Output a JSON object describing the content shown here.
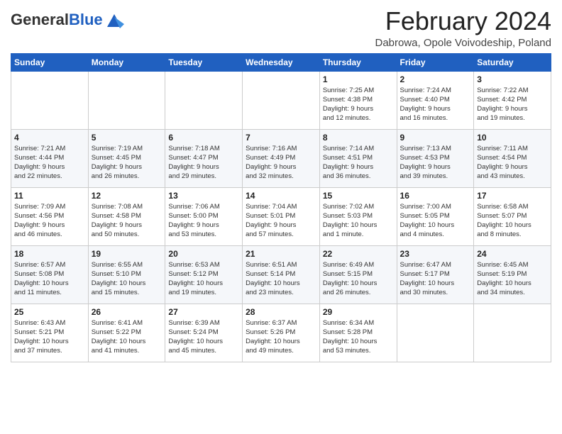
{
  "header": {
    "logo_general": "General",
    "logo_blue": "Blue",
    "month_title": "February 2024",
    "location": "Dabrowa, Opole Voivodeship, Poland"
  },
  "weekdays": [
    "Sunday",
    "Monday",
    "Tuesday",
    "Wednesday",
    "Thursday",
    "Friday",
    "Saturday"
  ],
  "weeks": [
    [
      {
        "day": "",
        "info": ""
      },
      {
        "day": "",
        "info": ""
      },
      {
        "day": "",
        "info": ""
      },
      {
        "day": "",
        "info": ""
      },
      {
        "day": "1",
        "info": "Sunrise: 7:25 AM\nSunset: 4:38 PM\nDaylight: 9 hours\nand 12 minutes."
      },
      {
        "day": "2",
        "info": "Sunrise: 7:24 AM\nSunset: 4:40 PM\nDaylight: 9 hours\nand 16 minutes."
      },
      {
        "day": "3",
        "info": "Sunrise: 7:22 AM\nSunset: 4:42 PM\nDaylight: 9 hours\nand 19 minutes."
      }
    ],
    [
      {
        "day": "4",
        "info": "Sunrise: 7:21 AM\nSunset: 4:44 PM\nDaylight: 9 hours\nand 22 minutes."
      },
      {
        "day": "5",
        "info": "Sunrise: 7:19 AM\nSunset: 4:45 PM\nDaylight: 9 hours\nand 26 minutes."
      },
      {
        "day": "6",
        "info": "Sunrise: 7:18 AM\nSunset: 4:47 PM\nDaylight: 9 hours\nand 29 minutes."
      },
      {
        "day": "7",
        "info": "Sunrise: 7:16 AM\nSunset: 4:49 PM\nDaylight: 9 hours\nand 32 minutes."
      },
      {
        "day": "8",
        "info": "Sunrise: 7:14 AM\nSunset: 4:51 PM\nDaylight: 9 hours\nand 36 minutes."
      },
      {
        "day": "9",
        "info": "Sunrise: 7:13 AM\nSunset: 4:53 PM\nDaylight: 9 hours\nand 39 minutes."
      },
      {
        "day": "10",
        "info": "Sunrise: 7:11 AM\nSunset: 4:54 PM\nDaylight: 9 hours\nand 43 minutes."
      }
    ],
    [
      {
        "day": "11",
        "info": "Sunrise: 7:09 AM\nSunset: 4:56 PM\nDaylight: 9 hours\nand 46 minutes."
      },
      {
        "day": "12",
        "info": "Sunrise: 7:08 AM\nSunset: 4:58 PM\nDaylight: 9 hours\nand 50 minutes."
      },
      {
        "day": "13",
        "info": "Sunrise: 7:06 AM\nSunset: 5:00 PM\nDaylight: 9 hours\nand 53 minutes."
      },
      {
        "day": "14",
        "info": "Sunrise: 7:04 AM\nSunset: 5:01 PM\nDaylight: 9 hours\nand 57 minutes."
      },
      {
        "day": "15",
        "info": "Sunrise: 7:02 AM\nSunset: 5:03 PM\nDaylight: 10 hours\nand 1 minute."
      },
      {
        "day": "16",
        "info": "Sunrise: 7:00 AM\nSunset: 5:05 PM\nDaylight: 10 hours\nand 4 minutes."
      },
      {
        "day": "17",
        "info": "Sunrise: 6:58 AM\nSunset: 5:07 PM\nDaylight: 10 hours\nand 8 minutes."
      }
    ],
    [
      {
        "day": "18",
        "info": "Sunrise: 6:57 AM\nSunset: 5:08 PM\nDaylight: 10 hours\nand 11 minutes."
      },
      {
        "day": "19",
        "info": "Sunrise: 6:55 AM\nSunset: 5:10 PM\nDaylight: 10 hours\nand 15 minutes."
      },
      {
        "day": "20",
        "info": "Sunrise: 6:53 AM\nSunset: 5:12 PM\nDaylight: 10 hours\nand 19 minutes."
      },
      {
        "day": "21",
        "info": "Sunrise: 6:51 AM\nSunset: 5:14 PM\nDaylight: 10 hours\nand 23 minutes."
      },
      {
        "day": "22",
        "info": "Sunrise: 6:49 AM\nSunset: 5:15 PM\nDaylight: 10 hours\nand 26 minutes."
      },
      {
        "day": "23",
        "info": "Sunrise: 6:47 AM\nSunset: 5:17 PM\nDaylight: 10 hours\nand 30 minutes."
      },
      {
        "day": "24",
        "info": "Sunrise: 6:45 AM\nSunset: 5:19 PM\nDaylight: 10 hours\nand 34 minutes."
      }
    ],
    [
      {
        "day": "25",
        "info": "Sunrise: 6:43 AM\nSunset: 5:21 PM\nDaylight: 10 hours\nand 37 minutes."
      },
      {
        "day": "26",
        "info": "Sunrise: 6:41 AM\nSunset: 5:22 PM\nDaylight: 10 hours\nand 41 minutes."
      },
      {
        "day": "27",
        "info": "Sunrise: 6:39 AM\nSunset: 5:24 PM\nDaylight: 10 hours\nand 45 minutes."
      },
      {
        "day": "28",
        "info": "Sunrise: 6:37 AM\nSunset: 5:26 PM\nDaylight: 10 hours\nand 49 minutes."
      },
      {
        "day": "29",
        "info": "Sunrise: 6:34 AM\nSunset: 5:28 PM\nDaylight: 10 hours\nand 53 minutes."
      },
      {
        "day": "",
        "info": ""
      },
      {
        "day": "",
        "info": ""
      }
    ]
  ]
}
